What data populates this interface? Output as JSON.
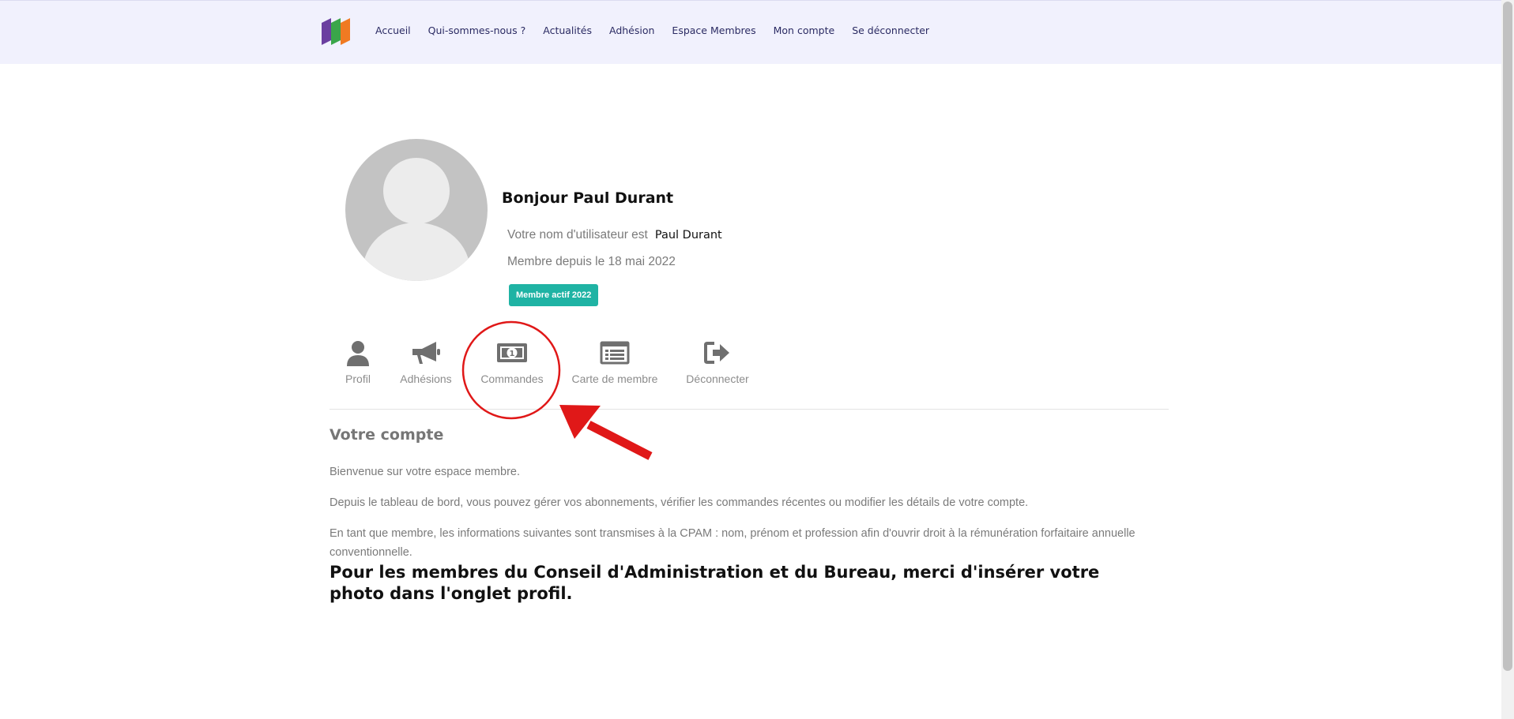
{
  "nav": {
    "logo_colors": [
      "#6b3fa0",
      "#3aa64a",
      "#f07a22"
    ],
    "items": [
      {
        "label": "Accueil"
      },
      {
        "label": "Qui-sommes-nous ?"
      },
      {
        "label": "Actualités"
      },
      {
        "label": "Adhésion"
      },
      {
        "label": "Espace Membres"
      },
      {
        "label": "Mon compte"
      },
      {
        "label": "Se déconnecter"
      }
    ]
  },
  "profile": {
    "greeting": "Bonjour Paul Durant",
    "username_label": "Votre nom d'utilisateur est",
    "username": "Paul Durant",
    "member_since": "Membre depuis le 18 mai 2022",
    "badge": "Membre actif 2022",
    "badge_color": "#1fb3a4"
  },
  "tabs": [
    {
      "label": "Profil",
      "icon": "user-icon"
    },
    {
      "label": "Adhésions",
      "icon": "megaphone-icon"
    },
    {
      "label": "Commandes",
      "icon": "banknote-icon",
      "highlighted": true
    },
    {
      "label": "Carte de membre",
      "icon": "list-card-icon"
    },
    {
      "label": "Déconnecter",
      "icon": "sign-out-icon"
    }
  ],
  "account": {
    "title": "Votre compte",
    "welcome": "Bienvenue sur votre espace membre.",
    "dashboard": "Depuis le tableau de bord, vous pouvez gérer vos abonnements, vérifier les commandes récentes ou modifier les détails de votre compte.",
    "cpam": "En tant que membre, les informations suivantes sont transmises à la CPAM : nom, prénom et profession afin d'ouvrir droit à la rémunération forfaitaire annuelle conventionnelle.",
    "notice": "Pour les membres du Conseil d'Administration et du Bureau, merci d'insérer votre photo dans l'onglet profil."
  },
  "annotation": {
    "color": "#e01818"
  }
}
